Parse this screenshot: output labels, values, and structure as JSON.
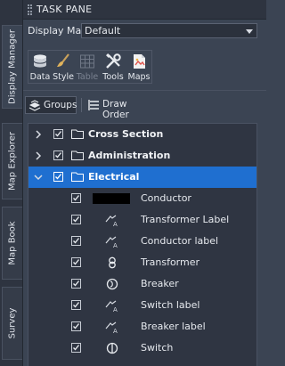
{
  "side_tabs": [
    "Display Manager",
    "Map Explorer",
    "Map Book",
    "Survey"
  ],
  "title": "TASK PANE",
  "display_map": {
    "label": "Display Map:",
    "value": "Default"
  },
  "toolbar": [
    {
      "label": "Data",
      "icon": "data-icon",
      "enabled": true
    },
    {
      "label": "Style",
      "icon": "style-brush-icon",
      "enabled": true
    },
    {
      "label": "Table",
      "icon": "table-icon",
      "enabled": false
    },
    {
      "label": "Tools",
      "icon": "tools-icon",
      "enabled": true
    },
    {
      "label": "Maps",
      "icon": "maps-icon",
      "enabled": true
    }
  ],
  "view_buttons": {
    "groups": "Groups",
    "draw_order": "Draw Order"
  },
  "groups": [
    {
      "name": "Cross Section",
      "expanded": false,
      "checked": true
    },
    {
      "name": "Administration",
      "expanded": false,
      "checked": true
    },
    {
      "name": "Electrical",
      "expanded": true,
      "checked": true,
      "selected": true
    }
  ],
  "layers": [
    {
      "name": "Conductor",
      "icon": "line-swatch-icon",
      "checked": true
    },
    {
      "name": "Transformer Label",
      "icon": "label-style-icon",
      "checked": true
    },
    {
      "name": "Conductor label",
      "icon": "label-style-icon",
      "checked": true
    },
    {
      "name": "Transformer",
      "icon": "transformer-symbol-icon",
      "checked": true
    },
    {
      "name": "Breaker",
      "icon": "breaker-symbol-icon",
      "checked": true
    },
    {
      "name": "Switch label",
      "icon": "label-style-icon",
      "checked": true
    },
    {
      "name": "Breaker label",
      "icon": "label-style-icon",
      "checked": true
    },
    {
      "name": "Switch",
      "icon": "switch-symbol-icon",
      "checked": true
    }
  ],
  "colors": {
    "selection": "#1f6fd0",
    "panel": "#3b4453",
    "tree": "#2f3542"
  }
}
